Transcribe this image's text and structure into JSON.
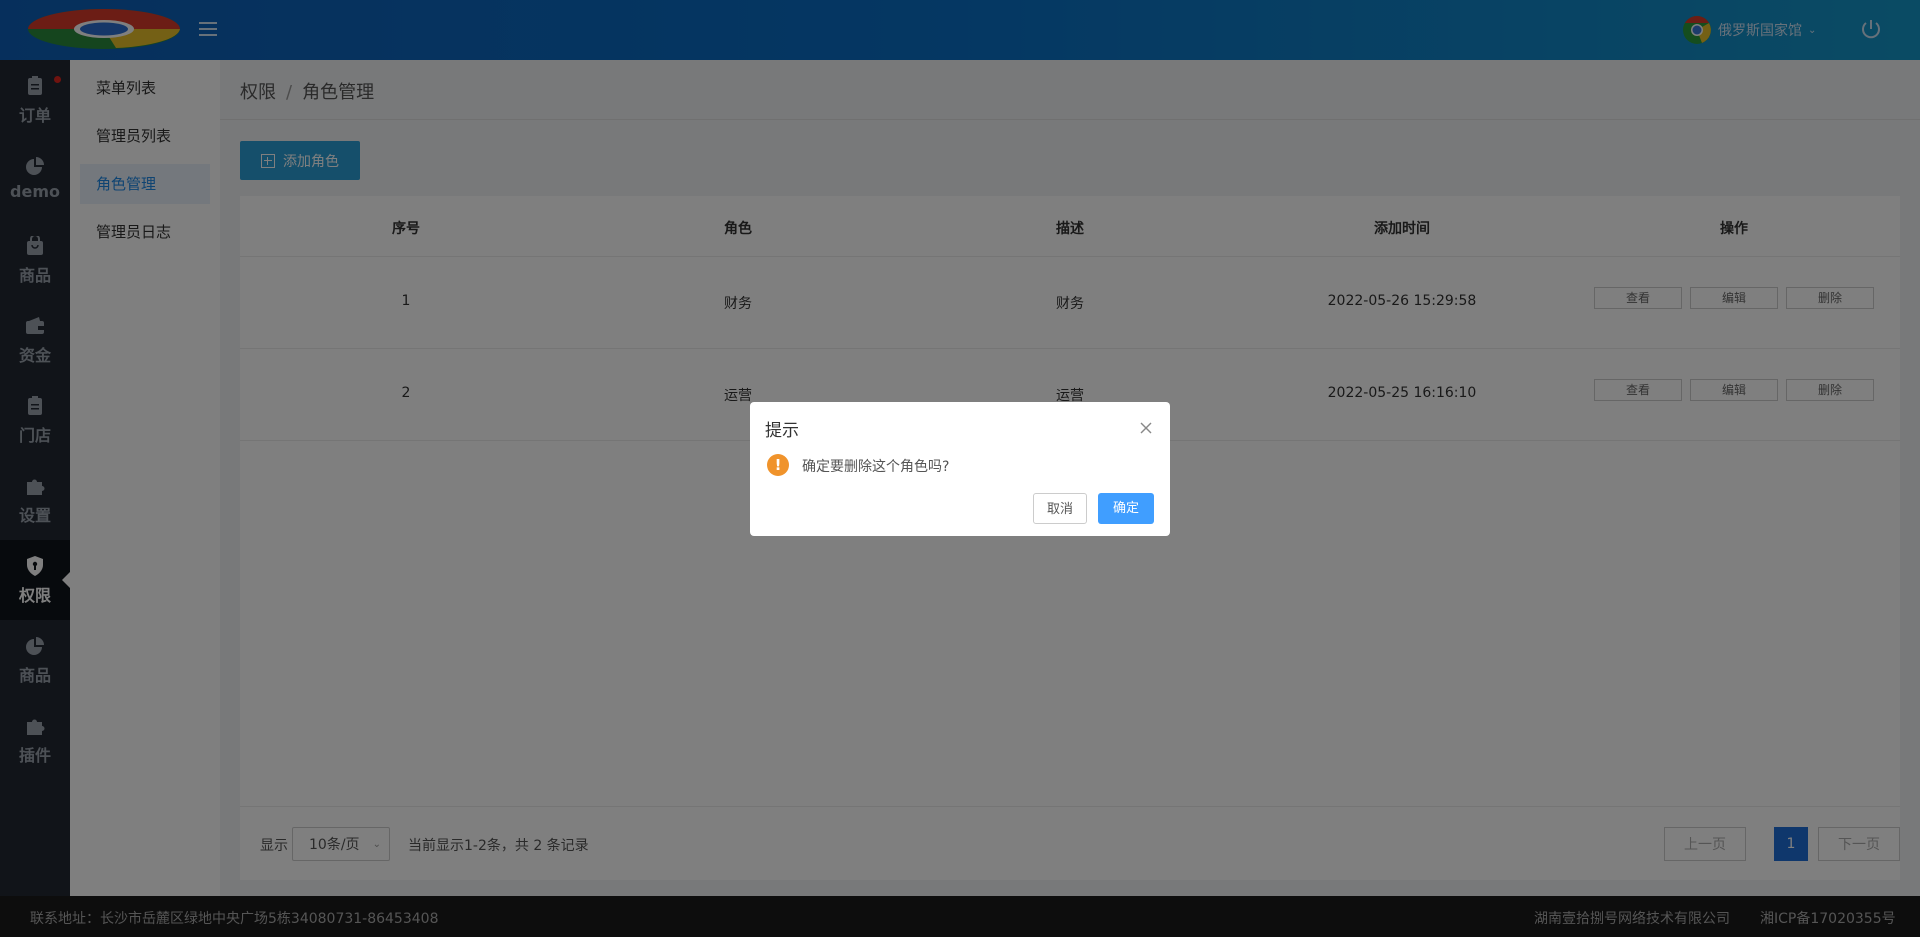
{
  "header": {
    "user_name": "俄罗斯国家馆"
  },
  "leftnav": [
    {
      "label": "订单",
      "icon": "clipboard-icon"
    },
    {
      "label": "demo",
      "icon": "pie-chart-icon"
    },
    {
      "label": "商品",
      "icon": "bag-icon"
    },
    {
      "label": "资金",
      "icon": "wallet-icon"
    },
    {
      "label": "门店",
      "icon": "clipboard-icon"
    },
    {
      "label": "设置",
      "icon": "puzzle-icon"
    },
    {
      "label": "权限",
      "icon": "shield-icon"
    },
    {
      "label": "商品",
      "icon": "pie-chart-icon"
    },
    {
      "label": "插件",
      "icon": "puzzle-icon"
    }
  ],
  "subnav": [
    "菜单列表",
    "管理员列表",
    "角色管理",
    "管理员日志"
  ],
  "breadcrumb": {
    "root": "权限",
    "sep": "/",
    "current": "角色管理"
  },
  "toolbar": {
    "add_label": "添加角色"
  },
  "table": {
    "headers": [
      "序号",
      "角色",
      "描述",
      "添加时间",
      "操作"
    ],
    "rows": [
      {
        "no": "1",
        "role": "财务",
        "desc": "财务",
        "time": "2022-05-26 15:29:58"
      },
      {
        "no": "2",
        "role": "运营",
        "desc": "运营",
        "time": "2022-05-25 16:16:10"
      }
    ],
    "actions": {
      "view": "查看",
      "edit": "编辑",
      "del": "删除"
    }
  },
  "pager": {
    "show_label": "显示",
    "page_size": "10条/页",
    "info": "当前显示1-2条，共 2 条记录",
    "prev": "上一页",
    "current": "1",
    "next": "下一页"
  },
  "footer": {
    "address": "联系地址：长沙市岳麓区绿地中央广场5栋34080731-86453408",
    "company": "湖南壹拾捌号网络技术有限公司",
    "icp": "湘ICP备17020355号"
  },
  "dialog": {
    "title": "提示",
    "message": "确定要删除这个角色吗?",
    "cancel": "取消",
    "ok": "确定",
    "warn_glyph": "!"
  },
  "colors": {
    "header_blue": "#0d5fb8",
    "accent": "#1e88e5",
    "warn": "#f0932b",
    "ok_button": "#409eff"
  }
}
